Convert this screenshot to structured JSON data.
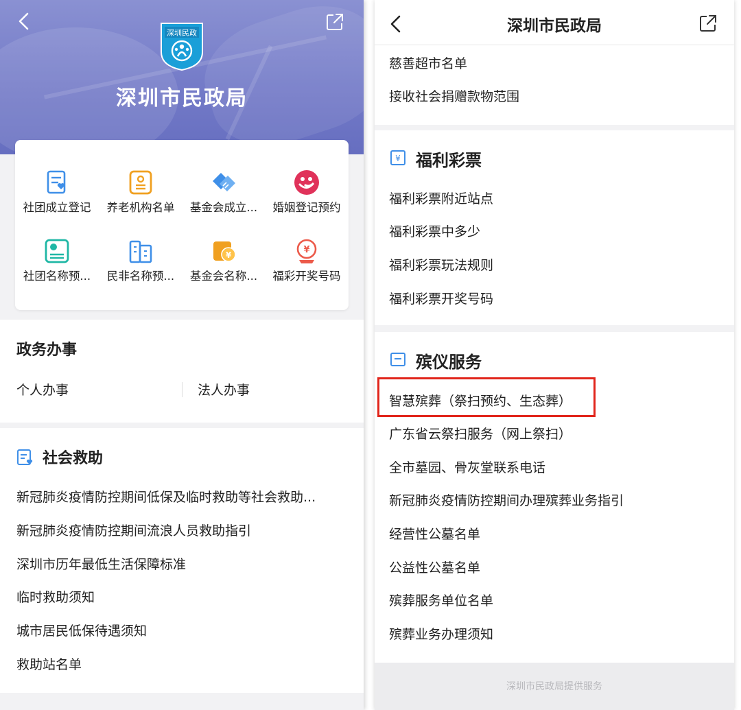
{
  "left": {
    "header": {
      "title": "深圳市民政局",
      "logo_text": "深圳民政"
    },
    "quick_actions": [
      {
        "label": "社团成立登记",
        "icon": "document-heart-icon",
        "color": "#3f8fe8"
      },
      {
        "label": "养老机构名单",
        "icon": "elderly-id-icon",
        "color": "#f0a020"
      },
      {
        "label": "基金会成立...",
        "icon": "handshake-icon",
        "color": "#3f8fe8"
      },
      {
        "label": "婚姻登记预约",
        "icon": "marriage-icon",
        "color": "#e0325a"
      },
      {
        "label": "社团名称预...",
        "icon": "society-name-icon",
        "color": "#1fb7a5"
      },
      {
        "label": "民非名称预...",
        "icon": "building-icon",
        "color": "#3f8fe8"
      },
      {
        "label": "基金会名称...",
        "icon": "foundation-fund-icon",
        "color": "#f0a020"
      },
      {
        "label": "福彩开奖号码",
        "icon": "lottery-icon",
        "color": "#ec5a4a"
      }
    ],
    "gov_affairs": {
      "title": "政务办事",
      "items": [
        "个人办事",
        "法人办事"
      ]
    },
    "social_aid": {
      "title": "社会救助",
      "items": [
        "新冠肺炎疫情防控期间低保及临时救助等社会救助...",
        "新冠肺炎疫情防控期间流浪人员救助指引",
        "深圳市历年最低生活保障标准",
        "临时救助须知",
        "城市居民低保待遇须知",
        "救助站名单"
      ]
    }
  },
  "right": {
    "header": {
      "title": "深圳市民政局"
    },
    "charity": {
      "items": [
        "慈善超市名单",
        "接收社会捐赠款物范围"
      ]
    },
    "lottery": {
      "title": "福利彩票",
      "items": [
        "福利彩票附近站点",
        "福利彩票中多少",
        "福利彩票玩法规则",
        "福利彩票开奖号码"
      ]
    },
    "funeral": {
      "title": "殡仪服务",
      "items": [
        "智慧殡葬（祭扫预约、生态葬）",
        "广东省云祭扫服务（网上祭扫）",
        "全市墓园、骨灰堂联系电话",
        "新冠肺炎疫情防控期间办理殡葬业务指引",
        "经营性公墓名单",
        "公益性公墓名单",
        "殡葬服务单位名单",
        "殡葬业务办理须知"
      ]
    },
    "footer": "深圳市民政局提供服务"
  },
  "colors": {
    "accent_blue": "#3f8fe8",
    "highlight_red": "#e1251b",
    "hero": "#747bc8"
  }
}
